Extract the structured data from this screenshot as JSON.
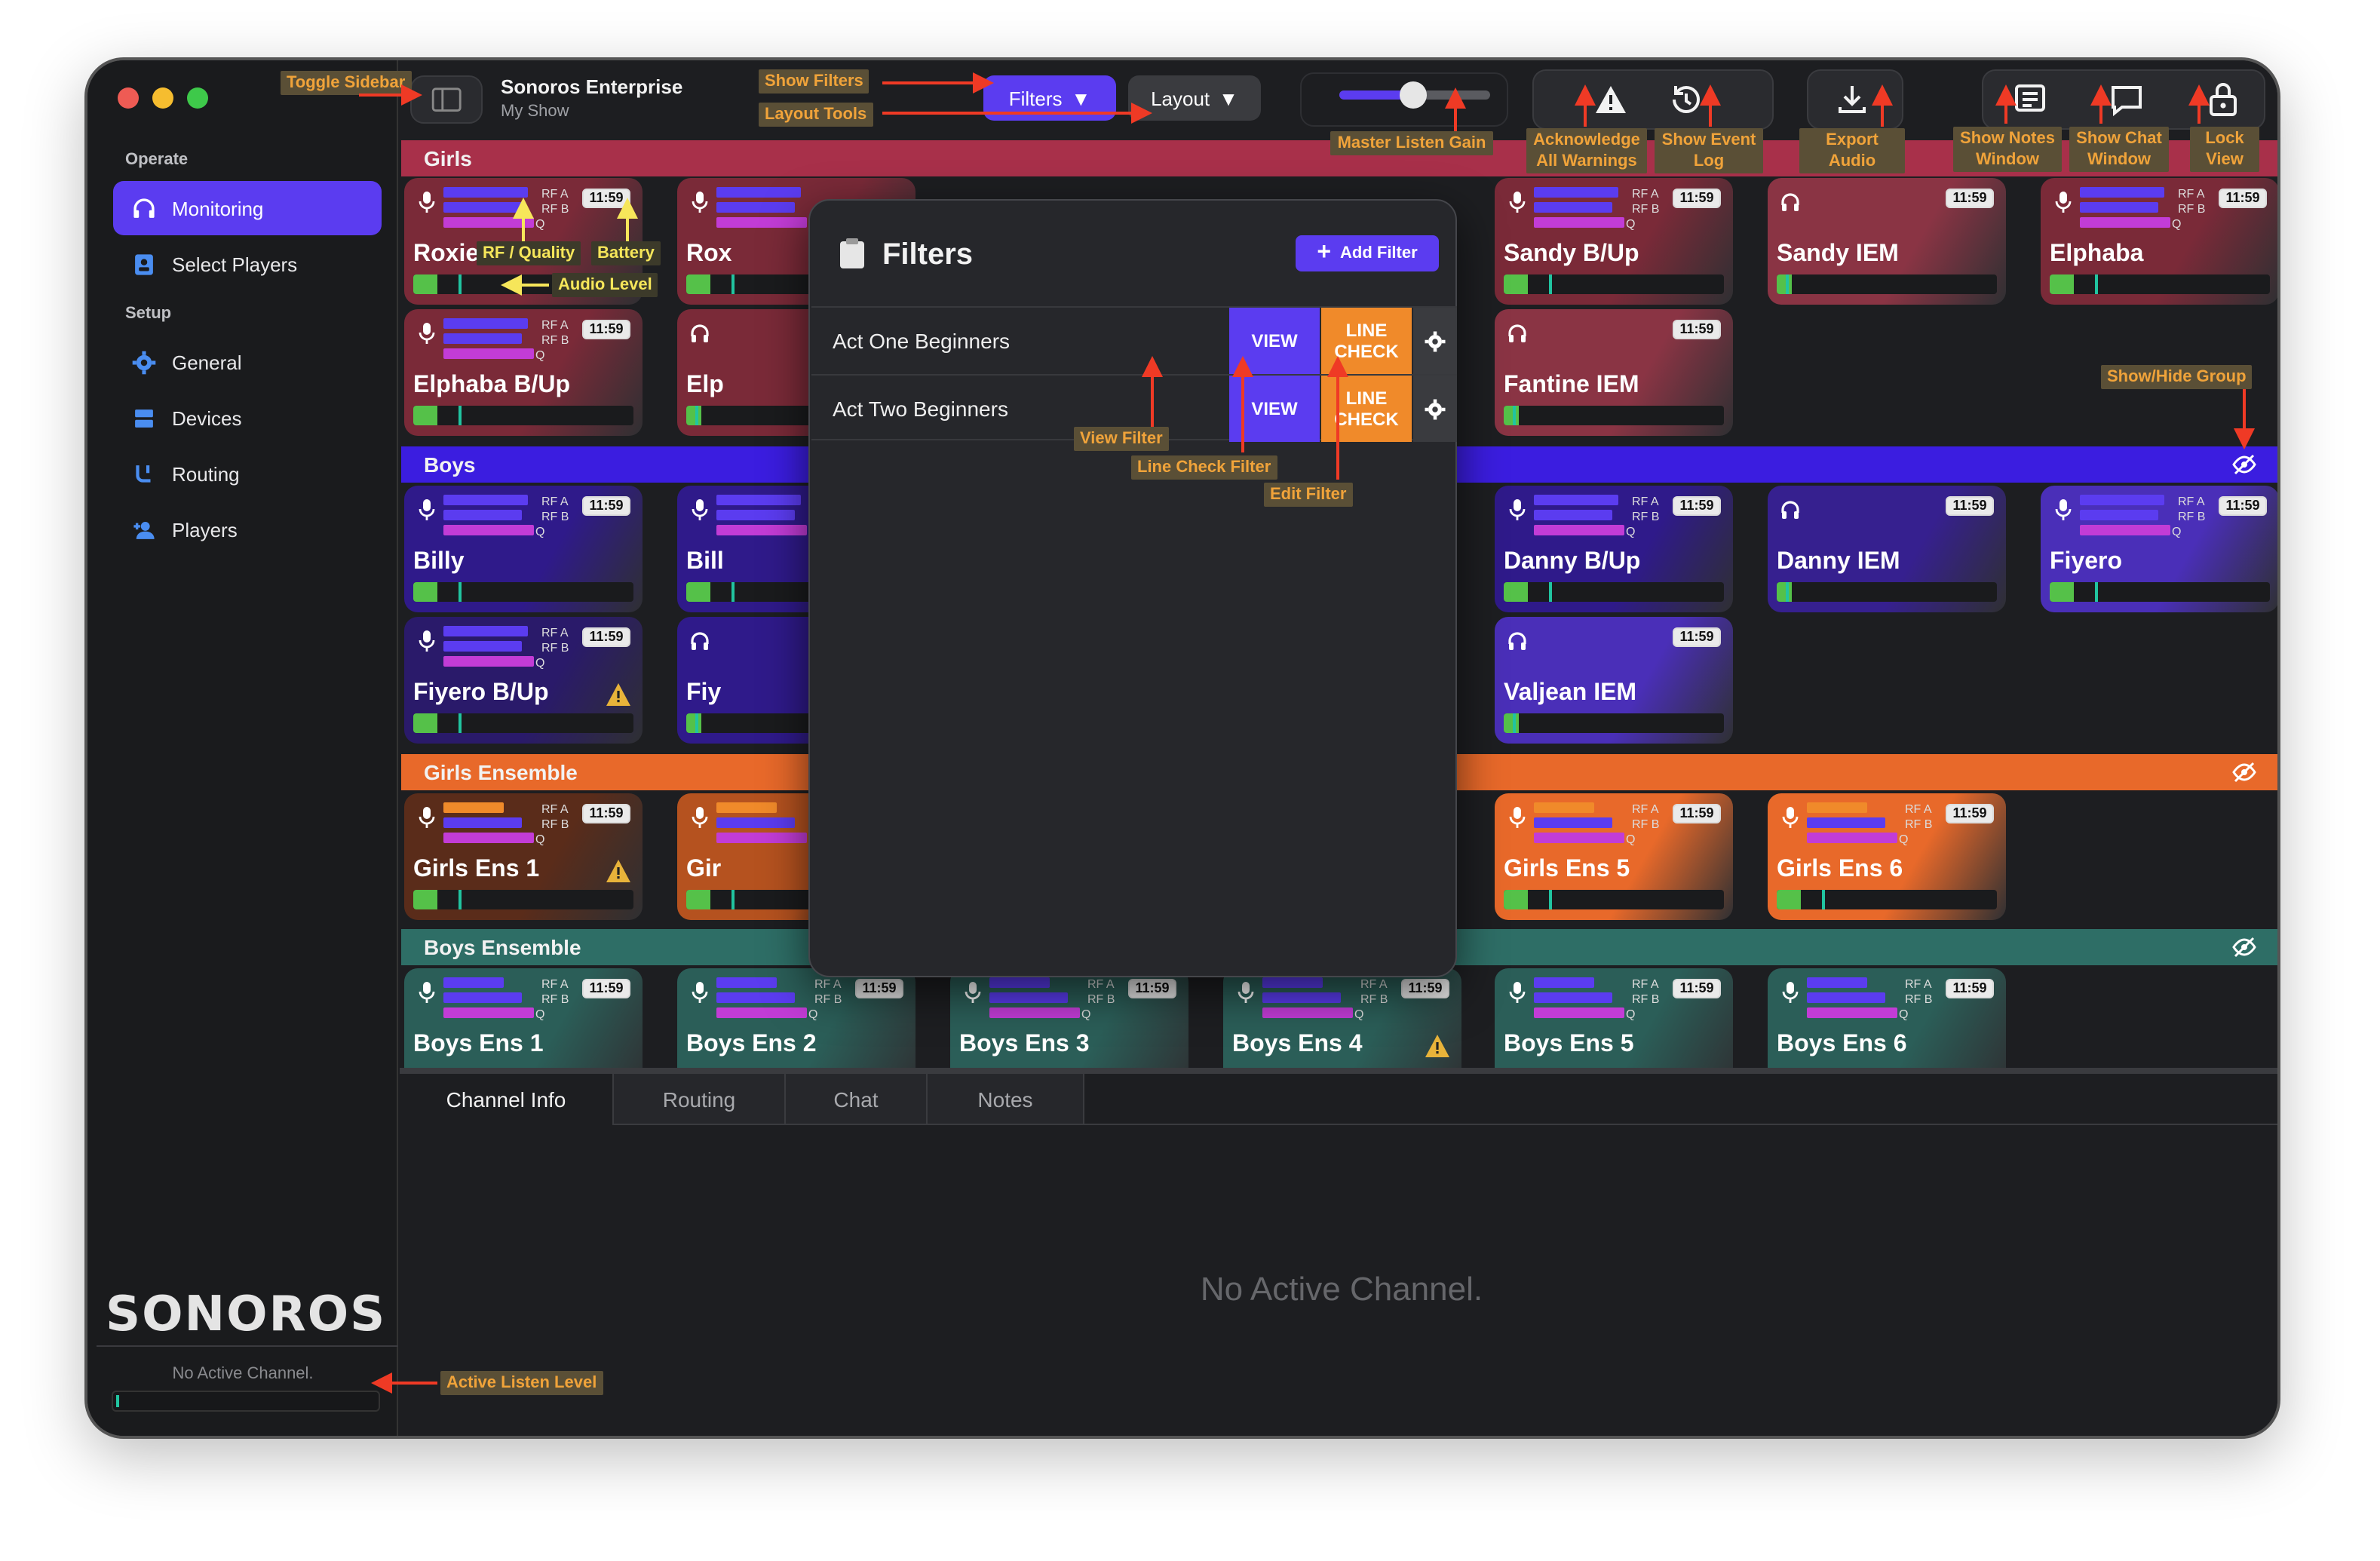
{
  "app": {
    "title": "Sonoros Enterprise",
    "subtitle": "My Show",
    "logo": "SONOROS"
  },
  "sidebar": {
    "operate_label": "Operate",
    "setup_label": "Setup",
    "items": [
      {
        "label": "Monitoring",
        "icon": "headphones-icon",
        "active": true
      },
      {
        "label": "Select Players",
        "icon": "id-badge-icon"
      },
      {
        "label": "General",
        "icon": "gear-icon"
      },
      {
        "label": "Devices",
        "icon": "server-icon"
      },
      {
        "label": "Routing",
        "icon": "routing-icon"
      },
      {
        "label": "Players",
        "icon": "add-person-icon"
      }
    ],
    "no_active": "No Active Channel."
  },
  "toolbar": {
    "filters": "Filters",
    "layout": "Layout",
    "battery": "11:59"
  },
  "groups": {
    "girls": "Girls",
    "boys": "Boys",
    "girls_ensemble": "Girls Ensemble",
    "boys_ensemble": "Boys Ensemble"
  },
  "channels": {
    "roxie": "Roxie",
    "rox": "Rox",
    "sandy_bup": "Sandy B/Up",
    "sandy_iem": "Sandy IEM",
    "elphaba": "Elphaba",
    "elphaba_bup": "Elphaba B/Up",
    "elp": "Elp",
    "fantine_iem": "Fantine IEM",
    "billy": "Billy",
    "bill": "Bill",
    "danny_bup": "Danny B/Up",
    "danny_iem": "Danny IEM",
    "fiyero": "Fiyero",
    "fiyero_bup": "Fiyero B/Up",
    "fiy": "Fiy",
    "valjean_iem": "Valjean IEM",
    "girls_ens_1": "Girls Ens 1",
    "gir": "Gir",
    "girls_ens_5": "Girls Ens 5",
    "girls_ens_6": "Girls Ens 6",
    "boys_ens_1": "Boys Ens 1",
    "boys_ens_2": "Boys Ens 2",
    "boys_ens_3": "Boys Ens 3",
    "boys_ens_4": "Boys Ens 4",
    "boys_ens_5": "Boys Ens 5",
    "boys_ens_6": "Boys Ens 6"
  },
  "meter_labels": {
    "rfa": "RF A",
    "rfb": "RF B",
    "q": "Q",
    "a": "A",
    "b": "B"
  },
  "filters_popover": {
    "title": "Filters",
    "add": "Add Filter",
    "view": "VIEW",
    "line_check": "LINE CHECK",
    "rows": [
      "Act One Beginners",
      "Act Two Beginners"
    ]
  },
  "bottom": {
    "tabs": [
      "Channel Info",
      "Routing",
      "Chat",
      "Notes"
    ],
    "empty": "No Active Channel."
  },
  "callouts": {
    "toggle_sidebar": "Toggle Sidebar",
    "show_filters": "Show Filters",
    "layout_tools": "Layout Tools",
    "master_gain": "Master Listen Gain",
    "ack_warnings": "Acknowledge All Warnings",
    "event_log": "Show Event Log",
    "export_audio": "Export Audio",
    "notes_window": "Show Notes Window",
    "chat_window": "Show Chat Window",
    "lock_view": "Lock View",
    "rf_quality": "RF / Quality",
    "battery": "Battery",
    "audio_level": "Audio Level",
    "show_hide_group": "Show/Hide Group",
    "view_filter": "View Filter",
    "line_check_filter": "Line Check Filter",
    "edit_filter": "Edit Filter",
    "active_listen": "Active Listen Level"
  },
  "colors": {
    "accent": "#5b3cf0",
    "girls": "#a8304a",
    "boys": "#3b1de0",
    "girls_ens": "#e8692a",
    "boys_ens": "#2e6e66",
    "callout": "#f0a33a"
  }
}
